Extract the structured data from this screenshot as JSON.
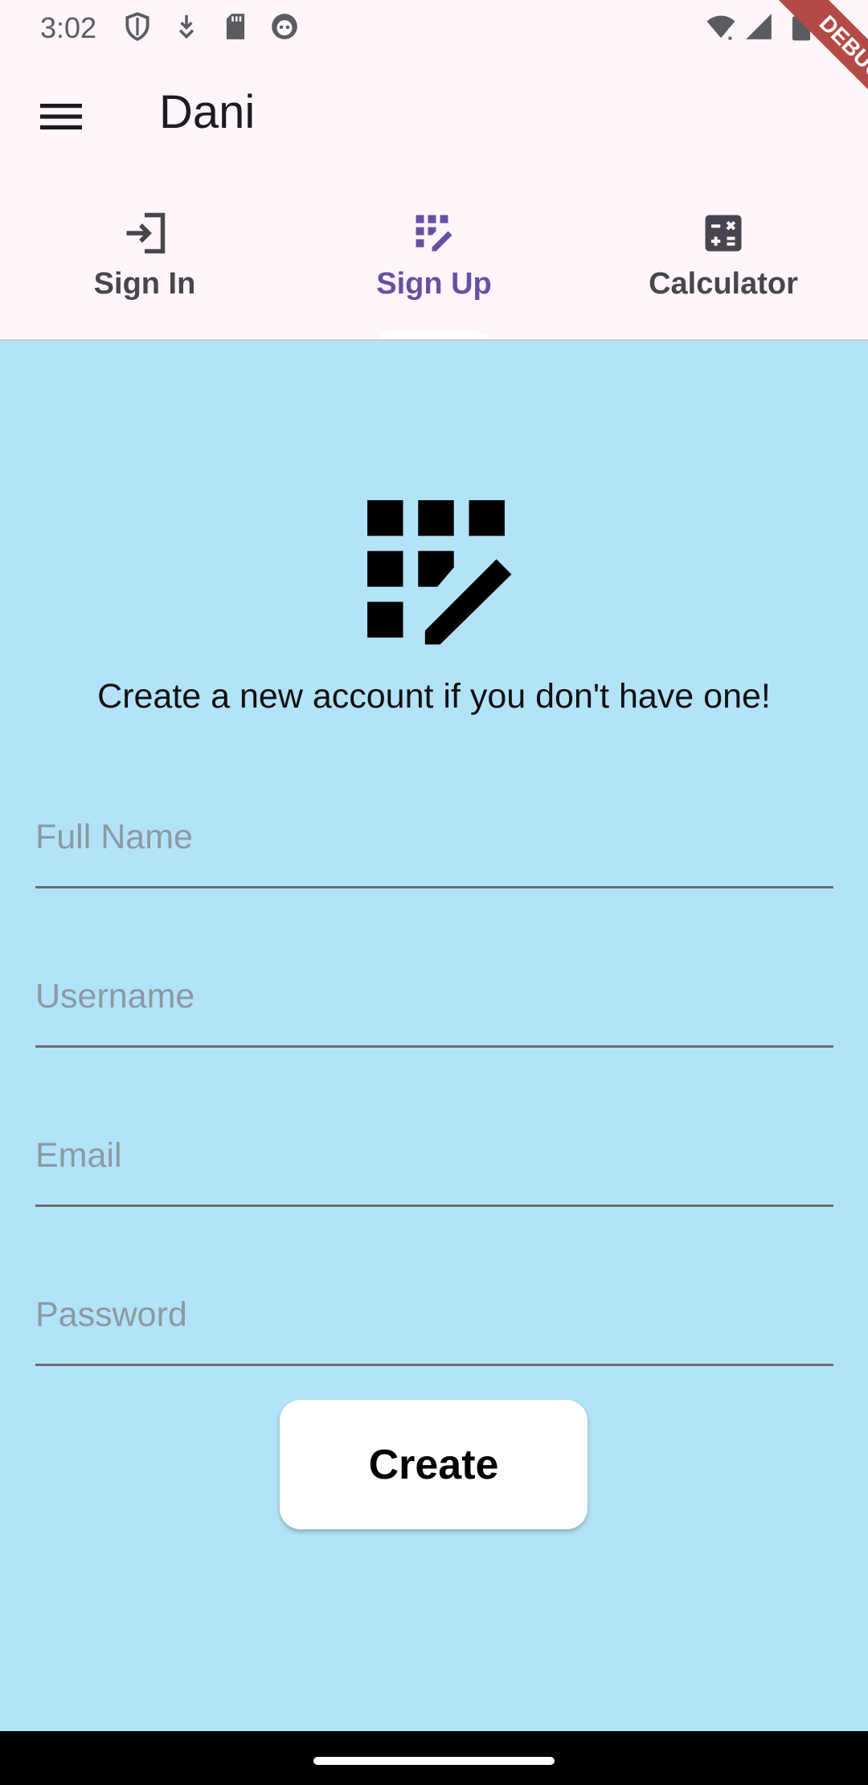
{
  "status_bar": {
    "time": "3:02",
    "icons": [
      "shield-icon",
      "download-icon",
      "sd-card-icon",
      "robot-icon",
      "wifi-icon",
      "signal-icon",
      "battery-icon"
    ]
  },
  "app_bar": {
    "title": "Dani",
    "menu_icon": "menu-icon"
  },
  "debug_banner": "DEBUG",
  "tabs": [
    {
      "label": "Sign In",
      "icon": "login-icon",
      "active": false
    },
    {
      "label": "Sign Up",
      "icon": "app-registration-icon",
      "active": true
    },
    {
      "label": "Calculator",
      "icon": "calculator-icon",
      "active": false
    }
  ],
  "main": {
    "hero_icon": "app-registration-icon",
    "subtitle": "Create a new account if you don't have one!",
    "fields": [
      {
        "placeholder": "Full Name",
        "value": ""
      },
      {
        "placeholder": "Username",
        "value": ""
      },
      {
        "placeholder": "Email",
        "value": ""
      },
      {
        "placeholder": "Password",
        "value": ""
      }
    ],
    "create_label": "Create"
  },
  "colors": {
    "background": "#b3e3f8",
    "app_bar": "#fef6fb",
    "accent": "#6750a4"
  }
}
